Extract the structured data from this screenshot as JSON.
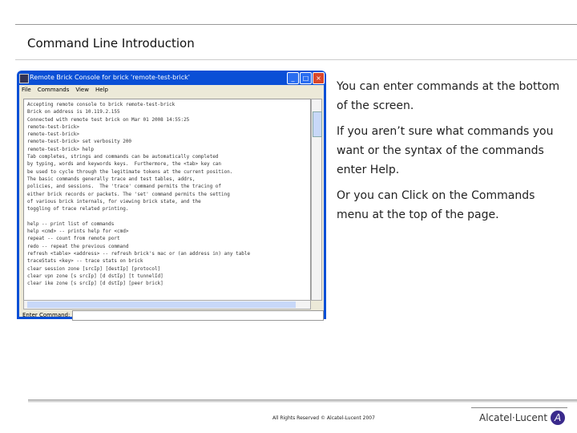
{
  "slide": {
    "title": "Command Line Introduction"
  },
  "window": {
    "title": "Remote Brick Console for brick 'remote-test-brick'",
    "menu": [
      "File",
      "Commands",
      "View",
      "Help"
    ],
    "console_lines": [
      "Accepting remote console to brick remote-test-brick",
      "Brick on address is 10.119.2.155",
      "Connected with remote test brick on Mar 01 2008 14:55:25",
      "remote-test-brick>",
      "remote-test-brick>",
      "remote-test-brick> set verbosity 200",
      "remote-test-brick> help",
      "Tab completes, strings and commands can be automatically completed",
      "by typing, words and keywords keys.  Furthermore, the <tab> key can",
      "be used to cycle through the legitimate tokens at the current position.",
      "The basic commands generally trace and test tables, addrs,",
      "policies, and sessions.  The 'trace' command permits the tracing of",
      "either brick records or packets. The 'set' command permits the setting",
      "of various brick internals, for viewing brick state, and the",
      "toggling of trace related printing.",
      "",
      "help -- print list of commands",
      "help <cmd> -- prints help for <cmd>",
      "repeat -- count from remote port",
      "redo -- repeat the previous command",
      "refresh <table> <address> -- refresh brick's mac or (an address in) any table",
      "traceStats <key> -- trace stats on brick",
      "clear session zone [srcIp] [destIp] [protocol]",
      "clear vpn zone [s srcIp] [d dstIp] [t tunnelId]",
      "clear ike zone [s srcIp] [d dstIp] [peer brick]"
    ],
    "command_label": "Enter Command:",
    "command_value": ""
  },
  "instructions": [
    "You can enter commands at the bottom of the screen.",
    "If you aren’t sure what commands you want or the syntax of the commands enter Help.",
    "Or you can Click on the Commands menu at the top of the page."
  ],
  "footer": {
    "copyright": "All Rights Reserved © Alcatel-Lucent 2007",
    "logo": "Alcatel·Lucent"
  }
}
